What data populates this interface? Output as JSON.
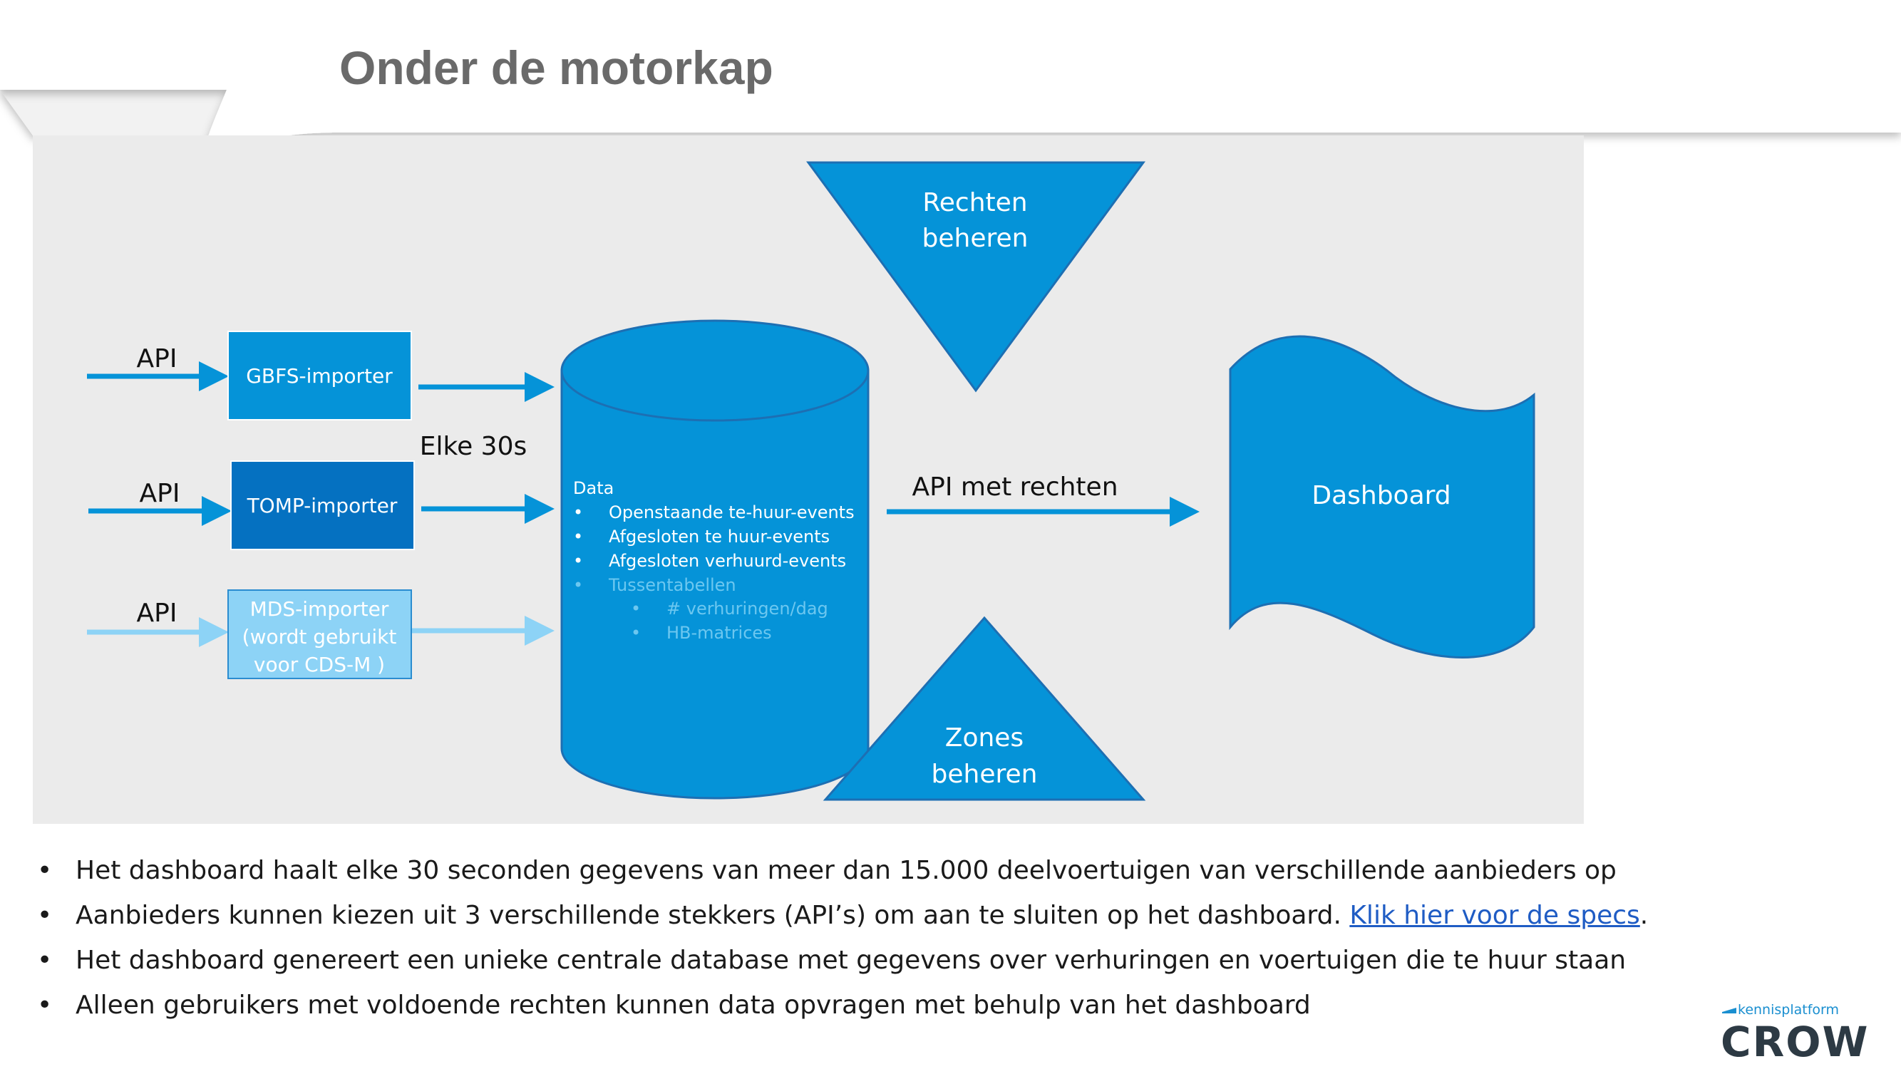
{
  "slide": {
    "title": "Onder de motorkap"
  },
  "diagram": {
    "api_labels": [
      "API",
      "API",
      "API"
    ],
    "importers": [
      {
        "lines": [
          "GBFS-importer"
        ]
      },
      {
        "lines": [
          "TOMP-importer"
        ]
      },
      {
        "lines": [
          "MDS-importer",
          "(wordt gebruikt",
          "voor CDS-M )"
        ]
      }
    ],
    "interval_label": "Elke 30s",
    "database": {
      "heading": "Data",
      "items": [
        "Openstaande te-huur-events",
        "Afgesloten te huur-events",
        "Afgesloten verhuurd-events"
      ],
      "muted_item": "Tussentabellen",
      "sub_items": [
        "# verhuringen/dag",
        "HB-matrices"
      ]
    },
    "rights": {
      "lines": [
        "Rechten",
        "beheren"
      ]
    },
    "zones": {
      "lines": [
        "Zones",
        "beheren"
      ]
    },
    "api_rights_label": "API met rechten",
    "dashboard_label": "Dashboard"
  },
  "bullets": [
    {
      "text": "Het dashboard haalt elke 30 seconden gegevens van meer dan 15.000 deelvoertuigen van verschillende aanbieders op"
    },
    {
      "text": "Aanbieders kunnen kiezen uit 3 verschillende stekkers (API’s) om aan te sluiten op het dashboard. ",
      "link": "Klik hier voor de specs",
      "suffix": "."
    },
    {
      "text": "Het dashboard genereert een unieke centrale database met gegevens over verhuringen en voertuigen die te huur staan"
    },
    {
      "text": "Alleen gebruikers met voldoende rechten kunnen data opvragen met behulp van het dashboard"
    }
  ],
  "logo": {
    "small": "kennisplatform",
    "large": "CROW"
  },
  "colors": {
    "primary": "#0593d8",
    "dark": "#0571c1",
    "light": "#8dd3f6",
    "panel": "#ebebeb",
    "title": "#6a6a6a",
    "link": "#1f5cc4",
    "logo": "#2d3a44"
  }
}
